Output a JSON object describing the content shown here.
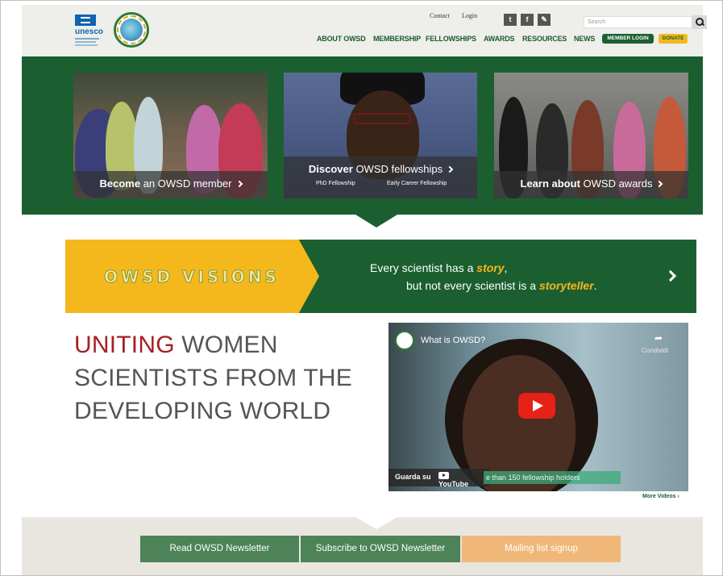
{
  "header": {
    "unesco_label": "unesco",
    "contact": "Contact",
    "login": "Login",
    "social": [
      {
        "name": "twitter-icon",
        "glyph": "t"
      },
      {
        "name": "facebook-icon",
        "glyph": "f"
      },
      {
        "name": "edit-icon",
        "glyph": "✎"
      }
    ],
    "search_placeholder": "Search",
    "nav": [
      "ABOUT OWSD",
      "MEMBERSHIP",
      "FELLOWSHIPS",
      "AWARDS",
      "RESOURCES",
      "NEWS"
    ],
    "member_login": "MEMBER LOGIN",
    "donate": "DONATE"
  },
  "hero": {
    "cards": [
      {
        "bold": "Become",
        "rest": " an OWSD member"
      },
      {
        "bold": "Discover",
        "rest": " OWSD fellowships",
        "sublinks": [
          "PhD Fellowship",
          "Early Career Fellowship"
        ]
      },
      {
        "bold": "Learn about",
        "rest": " OWSD awards"
      }
    ]
  },
  "visions": {
    "logo": "OWSD VISIONS",
    "line1_pre": "Every scientist has a ",
    "line1_em": "story",
    "line1_post": ",",
    "line2_pre": "but not every scientist is a ",
    "line2_em": "storyteller",
    "line2_post": "."
  },
  "headline": {
    "accent": "UNITING",
    "rest_line1": " WOMEN",
    "line2": "SCIENTISTS FROM THE",
    "line3": "DEVELOPING WORLD"
  },
  "video": {
    "title": "What is OWSD?",
    "share": "Condividi",
    "watch_on": "Guarda su",
    "youtube": "YouTube",
    "subtitle": "e than 150 fellowship holders",
    "more": "More Videos"
  },
  "footer": {
    "buttons": [
      {
        "label": "Read OWSD Newsletter",
        "color": "#4d8357"
      },
      {
        "label": "Subscribe to OWSD Newsletter",
        "color": "#4d8357"
      },
      {
        "label": "Mailing list signup",
        "color": "#f0b878"
      }
    ]
  },
  "colors": {
    "brand_green": "#1b5f30",
    "accent_yellow": "#f5b81c",
    "headline_red": "#a61f24"
  }
}
